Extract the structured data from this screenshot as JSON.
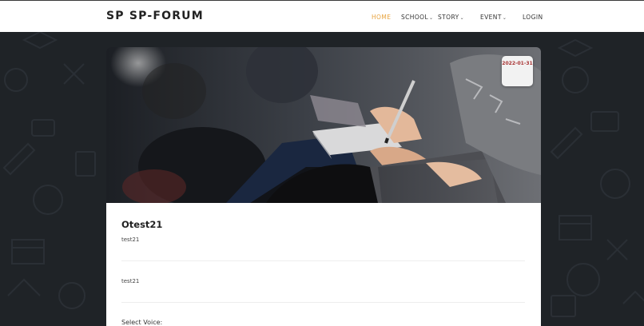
{
  "header": {
    "brand": "SP SP-FORUM",
    "nav": [
      {
        "label": "HOME",
        "active": true,
        "dropdown": false
      },
      {
        "label": "SCHOOL",
        "active": false,
        "dropdown": true
      },
      {
        "label": "STORY",
        "active": false,
        "dropdown": true
      },
      {
        "label": "EVENT",
        "active": false,
        "dropdown": true
      },
      {
        "label": "LOGIN",
        "active": false,
        "dropdown": false
      }
    ]
  },
  "post": {
    "date": "2022-01-31",
    "title": "Otest21",
    "summary": "test21",
    "content": "test21",
    "voice_label": "Select Voice:"
  },
  "colors": {
    "accent": "#e8a33d",
    "background": "#1f2327",
    "date_text": "#a83232"
  },
  "icons": {
    "chevron": "chevron-down-icon"
  }
}
